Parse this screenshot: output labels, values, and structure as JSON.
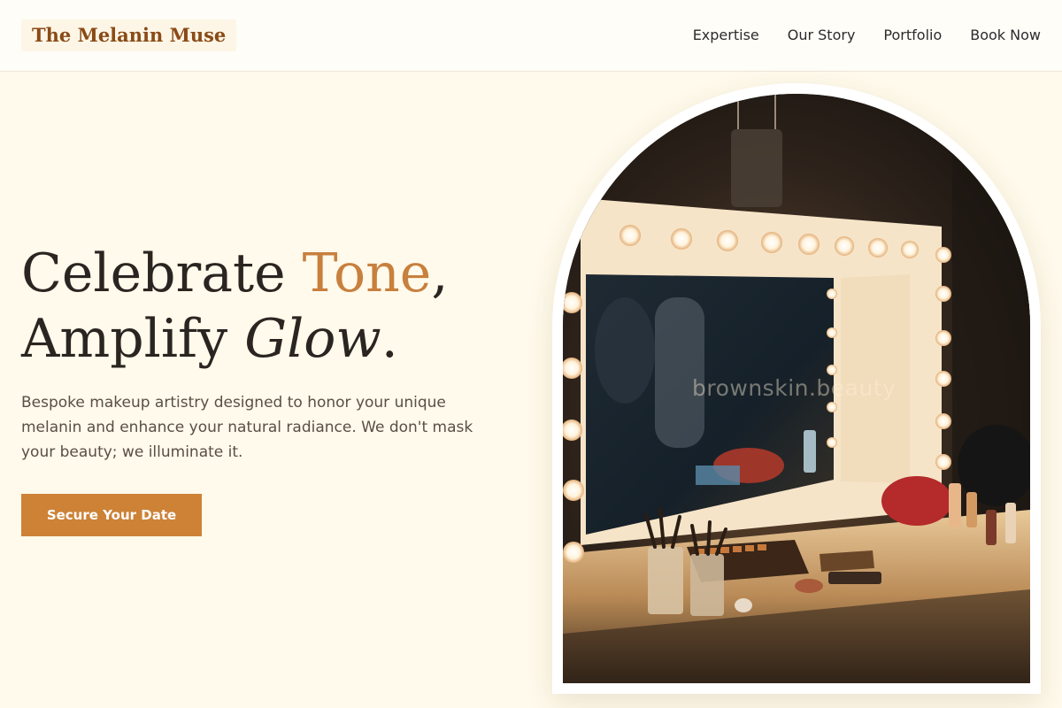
{
  "header": {
    "logo": "The Melanin Muse",
    "nav": [
      "Expertise",
      "Our Story",
      "Portfolio",
      "Book Now"
    ]
  },
  "hero": {
    "title_part1": "Celebrate ",
    "title_accent": "Tone",
    "title_comma": ",",
    "title_part2": "Amplify ",
    "title_italic": "Glow",
    "title_period": ".",
    "description": "Bespoke makeup artistry designed to honor your unique melanin and enhance your natural radiance. We don't mask your beauty; we illuminate it.",
    "cta_label": "Secure Your Date"
  },
  "image": {
    "watermark": "brownskin.beauty"
  },
  "colors": {
    "background": "#fffaeb",
    "brand": "#8a4b17",
    "accent": "#c8803e",
    "button": "#cd8236"
  }
}
